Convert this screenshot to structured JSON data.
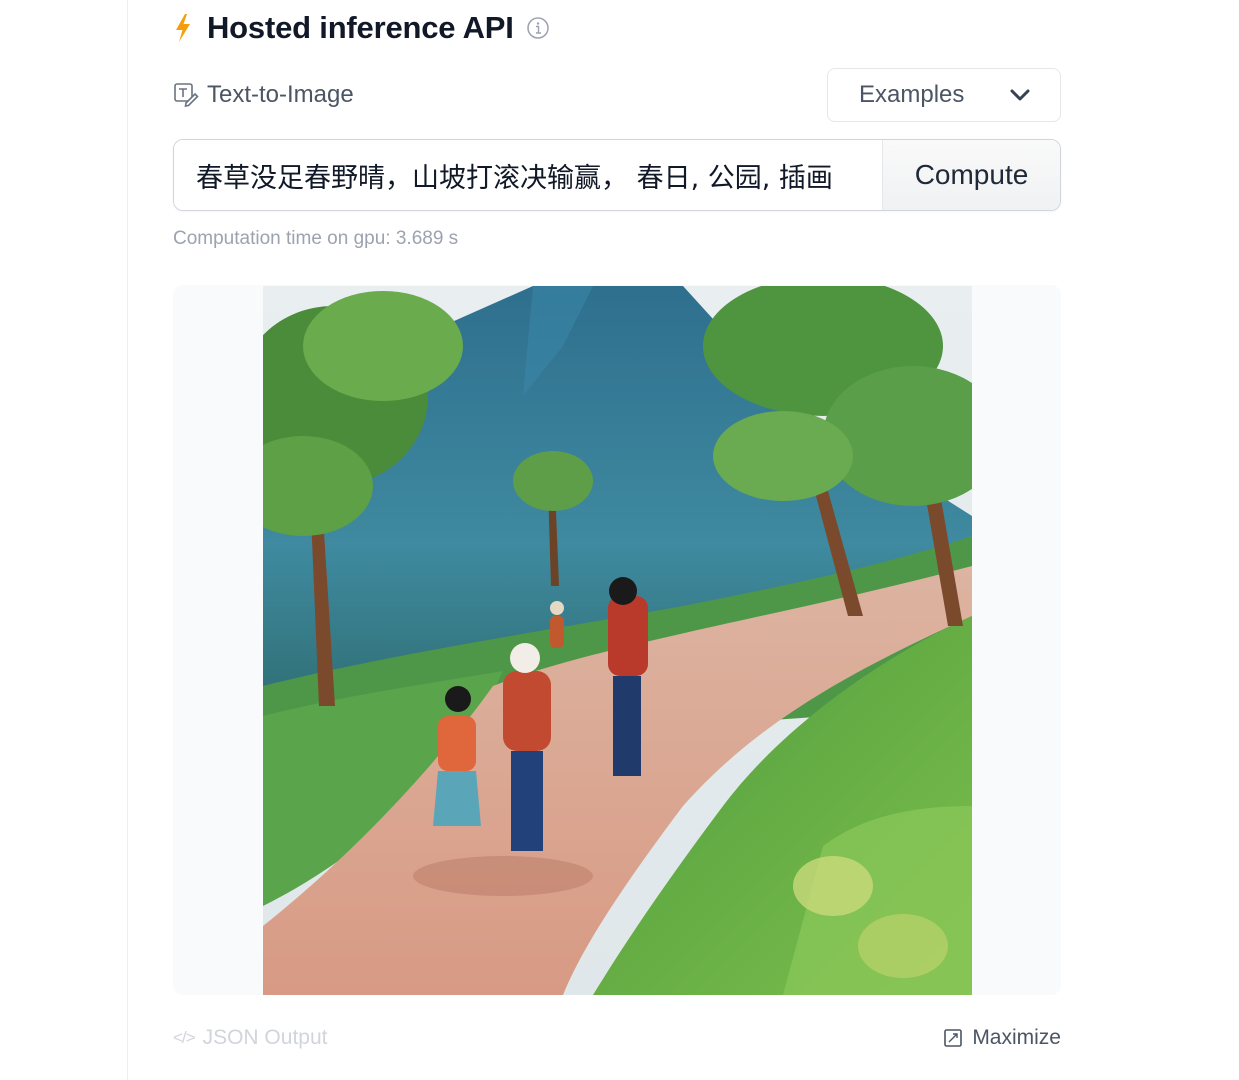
{
  "header": {
    "title": "Hosted inference API",
    "bolt_icon": "lightning-bolt-icon",
    "info_icon": "info-circle-icon"
  },
  "task": {
    "label": "Text-to-Image",
    "icon": "text-to-image-icon"
  },
  "examples": {
    "label": "Examples",
    "icon": "chevron-down-icon"
  },
  "prompt": {
    "value": "春草没足春野晴，山坡打滚决输赢， 春日, 公园, 插画"
  },
  "compute": {
    "label": "Compute"
  },
  "timing": {
    "text": "Computation time on gpu: 3.689 s"
  },
  "output_image": {
    "description_icon": "generated-image"
  },
  "footer": {
    "json_label": "JSON Output",
    "json_icon": "</>",
    "maximize_label": "Maximize",
    "maximize_icon": "maximize-icon"
  },
  "colors": {
    "accent": "#f59e0b",
    "text": "#111827",
    "muted": "#9ca3af"
  }
}
